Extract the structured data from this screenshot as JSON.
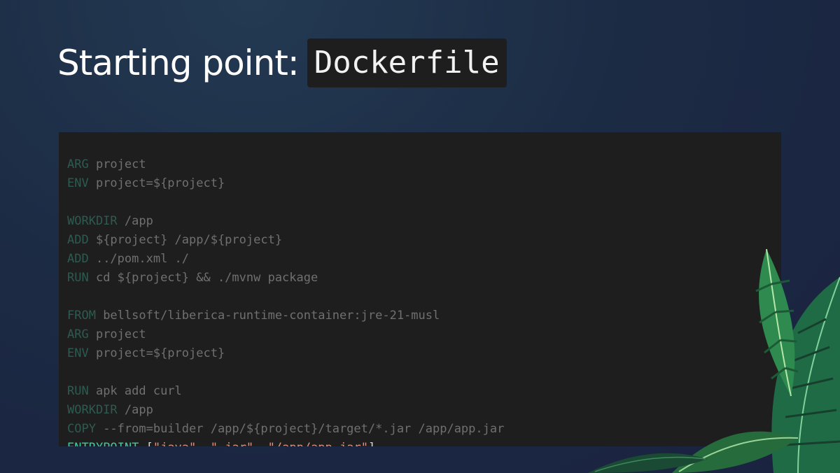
{
  "slide": {
    "title": "Starting point:",
    "title_code": "Dockerfile"
  },
  "code": {
    "lines": [
      {
        "kw": "",
        "text": ""
      },
      {
        "kw": "ARG",
        "text": " project"
      },
      {
        "kw": "ENV",
        "text": " project=${project}"
      },
      {
        "kw": "",
        "text": ""
      },
      {
        "kw": "WORKDIR",
        "text": " /app"
      },
      {
        "kw": "ADD",
        "text": " ${project} /app/${project}"
      },
      {
        "kw": "ADD",
        "text": " ../pom.xml ./"
      },
      {
        "kw": "RUN",
        "text": " cd ${project} && ./mvnw package"
      },
      {
        "kw": "",
        "text": ""
      },
      {
        "kw": "FROM",
        "text": " bellsoft/liberica-runtime-container:jre-21-musl"
      },
      {
        "kw": "ARG",
        "text": " project"
      },
      {
        "kw": "ENV",
        "text": " project=${project}"
      },
      {
        "kw": "",
        "text": ""
      },
      {
        "kw": "RUN",
        "text": " apk add curl"
      },
      {
        "kw": "WORKDIR",
        "text": " /app"
      },
      {
        "kw": "COPY",
        "text": " --from=builder /app/${project}/target/*.jar /app/app.jar"
      }
    ],
    "entrypoint": {
      "kw": "ENTRYPOINT",
      "open": " [",
      "arg1": "\"java\"",
      "sep1": ", ",
      "arg2": "\"-jar\"",
      "sep2": ", ",
      "arg3": "\"/app/app.jar\"",
      "close": "]"
    }
  },
  "colors": {
    "background": "#1c2b44",
    "code_background": "#1e1e1e",
    "keyword_active": "#3ec9a0",
    "string": "#e5917d",
    "dimmed_text": "#707070"
  },
  "icons": {
    "decoration": "tropical-leaves-icon"
  }
}
